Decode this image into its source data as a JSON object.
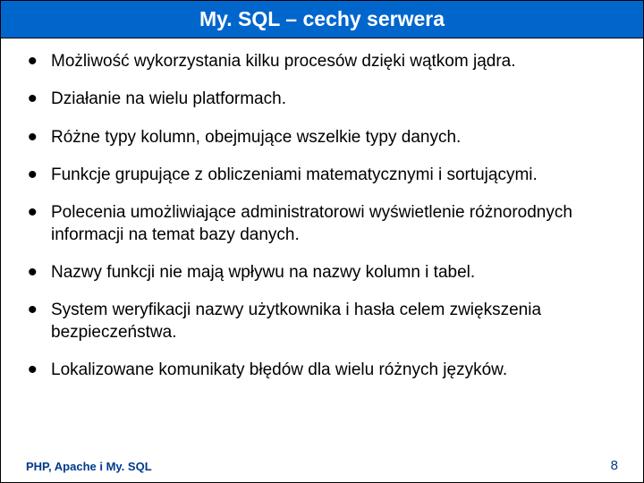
{
  "title": "My. SQL – cechy serwera",
  "bullets": [
    "Możliwość wykorzystania kilku procesów dzięki wątkom jądra.",
    "Działanie na wielu platformach.",
    "Różne typy kolumn, obejmujące wszelkie typy danych.",
    "Funkcje grupujące z obliczeniami matematycznymi i sortującymi.",
    "Polecenia umożliwiające administratorowi wyświetlenie różnorodnych informacji na temat bazy danych.",
    "Nazwy funkcji nie mają wpływu na nazwy kolumn i tabel.",
    "System weryfikacji nazwy użytkownika i hasła celem zwiększenia bezpieczeństwa.",
    "Lokalizowane komunikaty błędów dla wielu różnych języków."
  ],
  "footer": {
    "left": "PHP, Apache i My. SQL",
    "page": "8"
  }
}
